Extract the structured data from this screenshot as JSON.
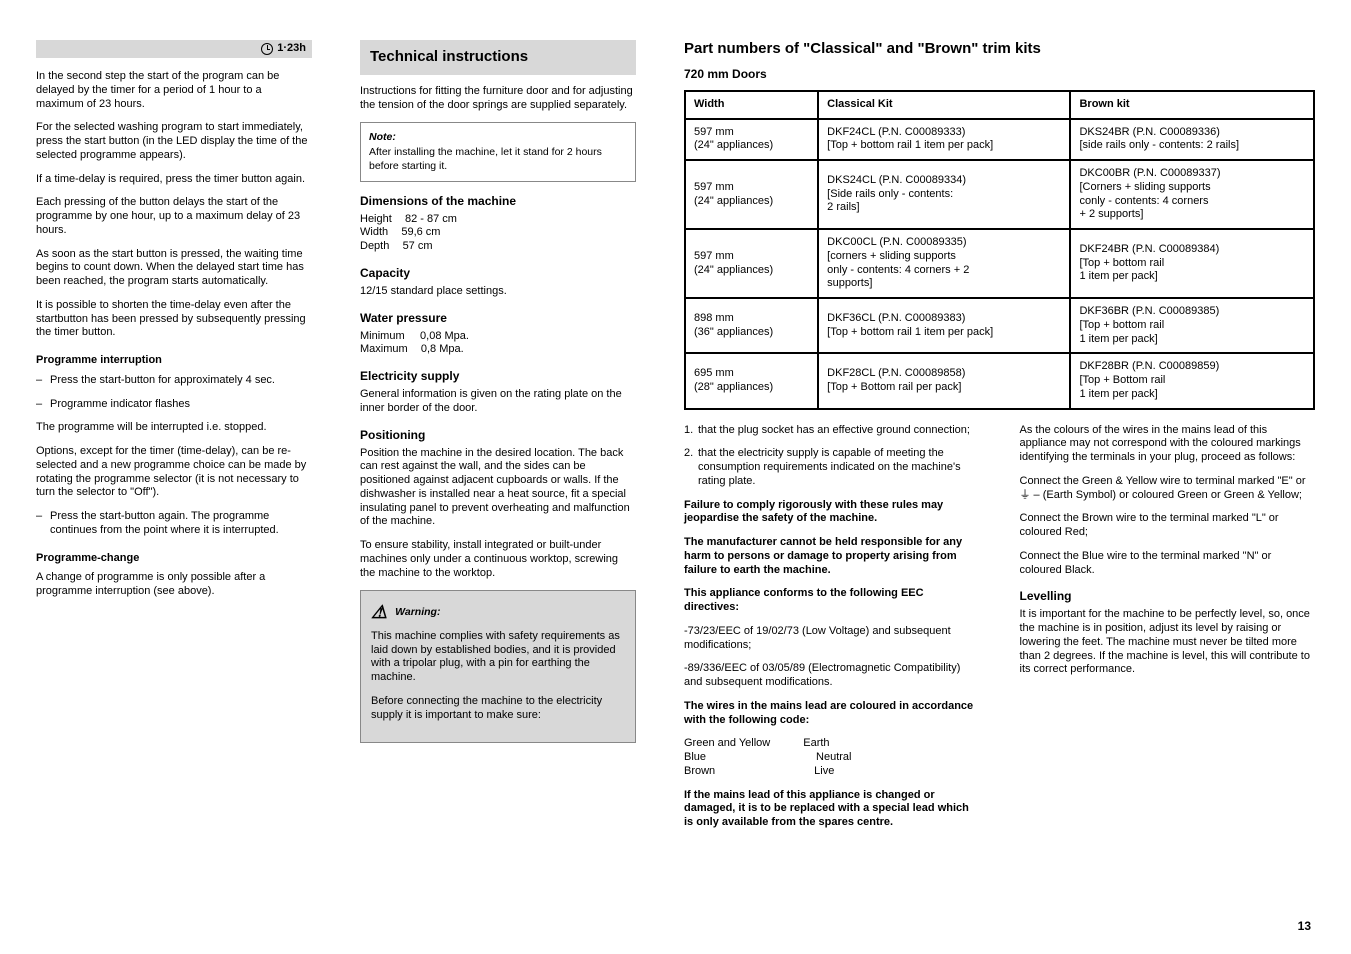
{
  "col1": {
    "band_label": "1·23h",
    "p1": "In the second step the start of the program can be delayed by the timer for a period of 1 hour to a maximum of 23 hours.",
    "p2": "For the selected washing program to start immediately, press the start button (in the LED display the time of the selected programme appears).",
    "p3": "If a time-delay is required, press the timer button again.",
    "p4": "Each pressing of the button delays the start of the programme by one hour, up to a maximum delay of 23 hours.",
    "p5": "As soon as the start button is pressed, the waiting time begins to count down. When the delayed start time has been reached, the program starts automatically.",
    "p6": "It is possible to shorten the time-delay even after the startbutton has been pressed by subsequently pressing the timer button.",
    "sub": "Programme interruption",
    "ind1": "Press the start-button for approximately 4 sec.",
    "ind2": "Programme indicator flashes",
    "p7": "The programme will be interrupted i.e. stopped.",
    "p8": "Options, except for the timer (time-delay), can be re-selected and a new programme choice can be made by rotating the programme selector (it is not necessary to turn the selector to \"Off\").",
    "ind3": "Press the start-button again. The programme continues from the point where it is interrupted.",
    "sub2": "Programme-change",
    "p9": "A change of programme is only possible after a programme interruption (see above)."
  },
  "col2": {
    "title": "Technical instructions",
    "p1": "Instructions for fitting the furniture door and for adjusting the tension of the door springs are supplied separately.",
    "note_title": "Note:",
    "note_body": "After installing the machine, let it stand for 2 hours before starting it.",
    "dims_title": "Dimensions of the machine",
    "dims": "Height      82 - 87 cm\nWidth      59,6 cm\nDepth      57 cm",
    "cap_title": "Capacity",
    "cap": "12/15 standard place settings.",
    "wp_title": "Water pressure",
    "wp": "Minimum       0,08 Mpa.\nMaximum      0,8 Mpa.",
    "es_title": "Electricity supply",
    "es": "General information is given on the rating plate on the inner border of the door.",
    "pos_title": "Positioning",
    "pos_body": "Position the machine in the desired location. The back can rest against the wall, and the sides can be positioned against adjacent cupboards or walls. If the dishwasher is installed near a heat source, fit a special insulating panel to prevent overheating and malfunction of the machine.",
    "pos_body2": "To ensure stability, install integrated or built-under machines only under a continuous worktop, screwing the machine to the worktop.",
    "warn_title": "Warning:",
    "warn1": "This machine complies with safety requirements as laid down by established bodies, and it is provided with a tripolar plug, with a pin for earthing the machine.",
    "warn2": "Before connecting the machine to the electricity supply it is important to make sure:"
  },
  "col3": {
    "title": "Part numbers of \"Classical\" and \"Brown\" trim kits",
    "sub": "720  mm Doors",
    "table": {
      "headers": [
        "Width",
        "Classical Kit",
        "Brown kit"
      ],
      "rows": [
        [
          "597 mm\n(24\" appliances)",
          "DKF24CL (P.N. C00089333)\n[Top + bottom rail 1 item per pack]",
          "DKS24BR (P.N. C00089336)\n[side rails only - contents: 2 rails]"
        ],
        [
          "597 mm\n(24\" appliances)",
          "DKS24CL (P.N. C00089334)\n[Side rails only - contents:\n2 rails]",
          "DKC00BR (P.N. C00089337)\n[Corners + sliding supports\nconly - contents: 4 corners\n+ 2 supports]"
        ],
        [
          "597 mm\n(24\" appliances)",
          "DKC00CL (P.N. C00089335)\n[corners + sliding supports\nonly - contents: 4 corners + 2\nsupports]",
          "DKF24BR (P.N. C00089384)\n[Top + bottom rail\n1 item per pack]"
        ],
        [
          "898 mm\n(36\" appliances)",
          "DKF36CL (P.N. C00089383)\n[Top + bottom rail 1 item per pack]",
          "DKF36BR (P.N. C00089385)\n[Top + bottom rail\n1 item per pack]"
        ],
        [
          "695 mm\n(28\" appliances)",
          "DKF28CL (P.N. C00089858)\n[Top + Bottom rail per pack]",
          "DKF28BR (P.N. C00089859)\n[Top + Bottom rail\n1 item per pack]"
        ]
      ]
    },
    "ind1": "that the plug socket has an effective ground connection;",
    "ind2": "that the electricity supply is capable of meeting the consumption requirements indicated on the machine's rating plate.",
    "warn1b": "Failure to comply rigorously with these rules may jeopardise the safety of the machine.",
    "warn2b": "The manufacturer cannot be held responsible for any harm to persons or damage to property arising from failure to earth the machine.",
    "warn3b": "This appliance conforms to the following EEC directives:",
    "conf1": "-73/23/EEC of 19/02/73 (Low Voltage)  and subsequent modifications;",
    "conf2": "-89/336/EEC of 03/05/89 (Electromagnetic Compatibility) and subsequent modifications.",
    "warn4b": "The wires in the mains lead are coloured in accordance with the following code:",
    "wirecolors": "Green and Yellow   Earth\nBlue          Neutral\nBrown         Live",
    "warn5b": "If the mains lead of this appliance is changed or damaged, it is to be replaced with a special lead which is only available from the spares centre.",
    "warn6b": "As the colours of the wires in the mains lead of this appliance may not correspond with the coloured markings identifying the terminals in your plug, proceed as follows:",
    "warn7b": "Connect the Green & Yellow wire to terminal marked \"E\" or ⏚ – (Earth Symbol) or coloured Green or Green & Yellow;",
    "warn8b": "Connect the Brown wire to the terminal marked \"L\" or coloured Red;",
    "warn9b": "Connect the Blue wire to the terminal marked \"N\" or coloured Black.",
    "leveling_title": "Levelling",
    "leveling_body": "It is important for the machine to be perfectly level, so, once the machine is in position, adjust its level by raising or lowering the feet. The machine must never be tilted more than 2 degrees. If the machine is level, this will contribute to its correct performance."
  },
  "page": "13"
}
